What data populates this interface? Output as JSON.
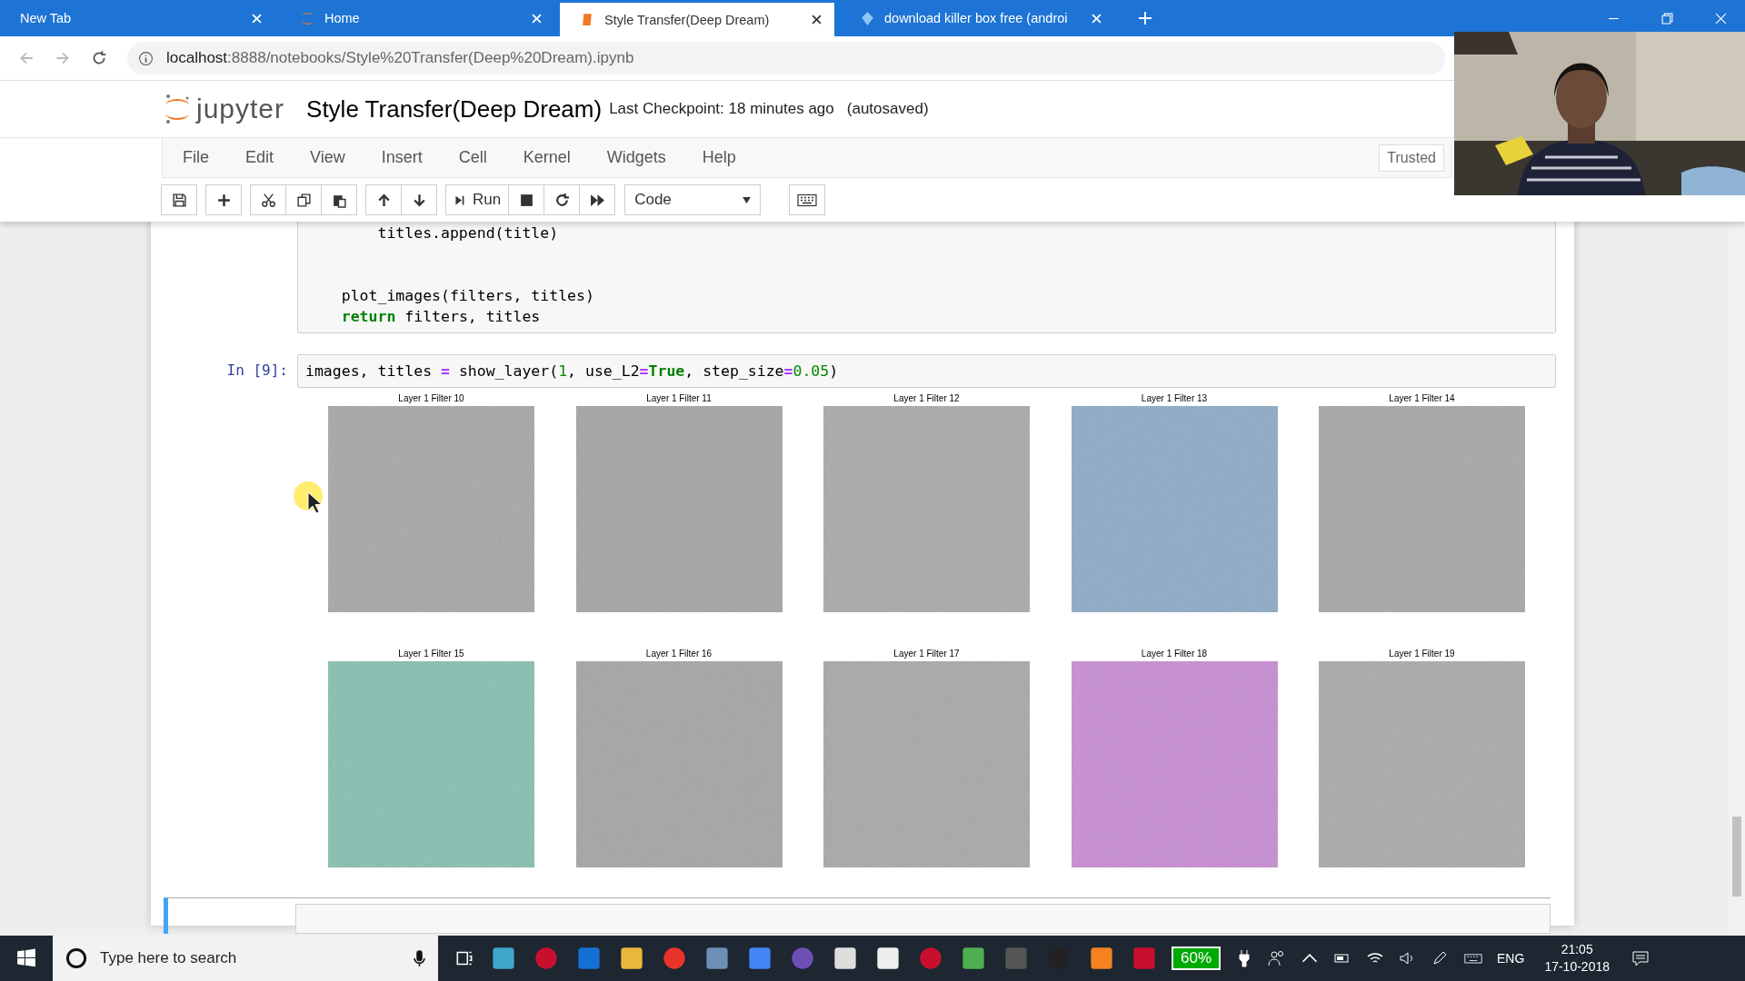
{
  "browser": {
    "tabs": [
      {
        "title": "New Tab",
        "selected": false
      },
      {
        "title": "Home",
        "selected": false
      },
      {
        "title": "Style Transfer(Deep Dream)",
        "selected": true
      },
      {
        "title": "download killer box free (androi",
        "selected": false
      }
    ],
    "url_host": "localhost",
    "url_rest": ":8888/notebooks/Style%20Transfer(Deep%20Dream).ipynb"
  },
  "header": {
    "logo_text": "jupyter",
    "title": "Style Transfer(Deep Dream)",
    "checkpoint": "Last Checkpoint: 18 minutes ago",
    "autosave": "(autosaved)"
  },
  "menu": [
    "File",
    "Edit",
    "View",
    "Insert",
    "Cell",
    "Kernel",
    "Widgets",
    "Help"
  ],
  "trusted": "Trusted",
  "toolbar": {
    "run_label": "Run",
    "cell_type": "Code"
  },
  "cells": [
    {
      "selected": false,
      "lines": [
        {
          "kind": "block",
          "children": [
            {
              "kind": "block",
              "children": [
                {
                  "kind": "code",
                  "tokens": [
                    {
                      "kind": "plain",
                      "text": "titles.append(title)"
                    }
                  ]
                }
              ]
            },
            {
              "kind": "blank"
            },
            {
              "kind": "blank"
            },
            {
              "kind": "code",
              "tokens": [
                {
                  "kind": "plain",
                  "text": "plot_images(filters, titles)"
                }
              ]
            },
            {
              "kind": "code",
              "tokens": [
                {
                  "kind": "keyword",
                  "text": "return"
                },
                {
                  "kind": "plain",
                  "text": " filters, titles"
                }
              ]
            }
          ]
        }
      ]
    },
    {
      "prompt": "In [9]:",
      "selected": false,
      "lines": [
        {
          "kind": "code",
          "tokens": [
            {
              "kind": "plain",
              "text": "images, titles "
            },
            {
              "kind": "operator",
              "text": "="
            },
            {
              "kind": "plain",
              "text": " show_layer("
            },
            {
              "kind": "number",
              "text": "1"
            },
            {
              "kind": "plain",
              "text": ", use_L2"
            },
            {
              "kind": "operator",
              "text": "="
            },
            {
              "kind": "keyword",
              "text": "True"
            },
            {
              "kind": "plain",
              "text": ", step_size"
            },
            {
              "kind": "operator",
              "text": "="
            },
            {
              "kind": "number",
              "text": "0.05"
            },
            {
              "kind": "plain",
              "text": ")"
            }
          ]
        }
      ]
    }
  ],
  "output_images": [
    {
      "title": "Layer 1 Filter 10",
      "color": "#a6a6a6"
    },
    {
      "title": "Layer 1 Filter 11",
      "color": "#a3a3a3"
    },
    {
      "title": "Layer 1 Filter 12",
      "color": "#a8a8a8"
    },
    {
      "title": "Layer 1 Filter 13",
      "color": "#8aaac6"
    },
    {
      "title": "Layer 1 Filter 14",
      "color": "#a7a6a4"
    },
    {
      "title": "Layer 1 Filter 15",
      "color": "#84bfb0"
    },
    {
      "title": "Layer 1 Filter 16",
      "color": "#a4a4a4"
    },
    {
      "title": "Layer 1 Filter 17",
      "color": "#a7a7a7"
    },
    {
      "title": "Layer 1 Filter 18",
      "color": "#c88ad3"
    },
    {
      "title": "Layer 1 Filter 19",
      "color": "#a8a9a8"
    }
  ],
  "next_cell": {
    "selected": true
  },
  "taskbar": {
    "search_placeholder": "Type here to search",
    "battery": "60%",
    "language": "ENG",
    "time": "21:05",
    "date": "17-10-2018"
  }
}
